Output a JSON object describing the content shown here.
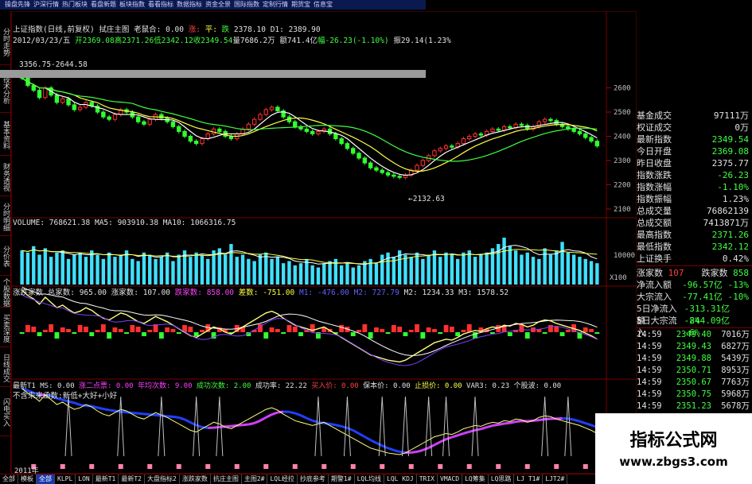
{
  "topbar": {
    "items": [
      "操盘先锋",
      "沪深行情",
      "热门板块",
      "看盘新题",
      "板块指数",
      "看看指标",
      "数据指标",
      "资金全景",
      "国际指数",
      "定制行情",
      "期货宝",
      "信息宝"
    ]
  },
  "left_tabs": [
    "分时走势",
    "技术分析",
    "基本资料",
    "财务透视",
    "分时明细",
    "分价表",
    "个股数据",
    "买卖深度",
    "日线成交",
    "闪电买入"
  ],
  "price_header": {
    "line1_title": "上证指数",
    "line1_sub": "(日线,前复权)",
    "line1_main": "拭庄主图",
    "line1_ratio": "老鼠合: 0.00",
    "line1_up": "涨:",
    "line1_flat": "平:",
    "line1_down": "跌",
    "line1_v1": "2378.10",
    "line1_d1": "D1: 2389.90",
    "line2_date": "2012/03/23/五",
    "line2_open": "开2369.08",
    "line2_high": "高2371.26",
    "line2_low": "低2342.12",
    "line2_close": "收2349.54",
    "line2_vol": "量7686.2万",
    "line2_amt": "额741.4亿",
    "line2_chg": "幅-26.23(-1.10%)",
    "line2_amp": "振29.14(1.23%"
  },
  "price_annotations": {
    "high_label": "3356.75-2644.58",
    "low_label": "←2132.63"
  },
  "volume_header": {
    "vol": "VOLUME: 768621.38",
    "ma5": "MA5: 903910.38",
    "ma10": "MA10: 1066316.75"
  },
  "adl_header": {
    "title": "涨跌家数",
    "total": "总家数: 965.00",
    "up": "涨家数: 107.00",
    "down": "跌家数: 858.00",
    "diff": "差数: -751.00",
    "m1": "M1: -476.00",
    "m1b": "M2: 727.79",
    "m2": "M2: 1234.33",
    "m3": "M3: 1578.52"
  },
  "ind_header": {
    "l1_a": "最新T1",
    "l1_b": "MS: 0.00",
    "l1_c": "涨二点票: 0.00",
    "l1_d": "年均次数: 9.00",
    "l1_e": "成功次数: 2.00",
    "l1_f": "成功率: 22.22",
    "l1_g": "买入价: 0.00",
    "l1_h": "保本价: 0.00",
    "l1_i": "止损价: 0.00",
    "l1_j": "VAR3: 0.23",
    "l1_k": "个股波: 0.00",
    "l2": "不含未来函数:新低+大好+小好"
  },
  "price_axis": [
    "2600",
    "2500",
    "2400",
    "2300",
    "2200",
    "2100"
  ],
  "volume_axis": [
    "10000",
    "X100"
  ],
  "right_panel": {
    "rows": [
      {
        "k": "基金成交",
        "v": "97111万",
        "c": "w"
      },
      {
        "k": "权证成交",
        "v": "0万",
        "c": "w"
      },
      {
        "k": "最新指数",
        "v": "2349.54",
        "c": "g"
      },
      {
        "k": "今日开盘",
        "v": "2369.08",
        "c": "g"
      },
      {
        "k": "昨日收盘",
        "v": "2375.77",
        "c": "w"
      },
      {
        "k": "指数涨跌",
        "v": "-26.23",
        "c": "g"
      },
      {
        "k": "指数涨幅",
        "v": "-1.10%",
        "c": "g"
      },
      {
        "k": "指数振幅",
        "v": "1.23%",
        "c": "w"
      },
      {
        "k": "总成交量",
        "v": "76862139",
        "c": "w"
      },
      {
        "k": "总成交额",
        "v": "7413871万",
        "c": "w"
      },
      {
        "k": "最高指数",
        "v": "2371.26",
        "c": "g"
      },
      {
        "k": "最低指数",
        "v": "2342.12",
        "c": "g"
      },
      {
        "k": "上证换手",
        "v": "0.42%",
        "c": "w"
      }
    ],
    "updown": {
      "up_label": "涨家数",
      "up_val": "107",
      "down_label": "跌家数",
      "down_val": "858"
    },
    "flows": [
      {
        "k": "净流入额",
        "v": "-96.57亿",
        "p": "-13%"
      },
      {
        "k": "大宗流入",
        "v": "-77.41亿",
        "p": "-10%"
      },
      {
        "k": "5日净流入额",
        "v": "-313.31亿",
        "p": "-8%"
      },
      {
        "k": "5日大宗流入",
        "v": "-244.09亿",
        "p": "-6%"
      }
    ],
    "ticks": [
      {
        "t": "14:59",
        "p": "2349.40",
        "v": "7016万"
      },
      {
        "t": "14:59",
        "p": "2349.43",
        "v": "6827万"
      },
      {
        "t": "14:59",
        "p": "2349.88",
        "v": "5439万"
      },
      {
        "t": "14:59",
        "p": "2350.71",
        "v": "8953万"
      },
      {
        "t": "14:59",
        "p": "2350.67",
        "v": "7763万"
      },
      {
        "t": "14:59",
        "p": "2350.75",
        "v": "5968万"
      },
      {
        "t": "14:59",
        "p": "2351.23",
        "v": "5678万"
      }
    ]
  },
  "watermark": {
    "line1": "指标公式网",
    "line2": "www.zbgs3.com"
  },
  "bottom_tabs": [
    "全部",
    "模板",
    "全部",
    "KLPL",
    "LON",
    "最新T1",
    "最新T2",
    "大盘指标2",
    "涨跌家数",
    "抗庄主图",
    "主图2#",
    "LQL经拉",
    "抄底参考",
    "期警1#",
    "LQL均线",
    "LQL KDJ",
    "TRIX",
    "VMACD",
    "LQ筹集",
    "LQ思路",
    "LJ T1#",
    "LJT2#"
  ],
  "bottom_active_index": 2,
  "year_label": "2011年",
  "chart_data": {
    "type": "candlestick",
    "price_range": [
      2080,
      2720
    ],
    "closes": [
      2640,
      2610,
      2590,
      2560,
      2600,
      2570,
      2540,
      2555,
      2530,
      2510,
      2520,
      2540,
      2525,
      2500,
      2480,
      2470,
      2490,
      2510,
      2500,
      2480,
      2460,
      2450,
      2470,
      2490,
      2475,
      2460,
      2440,
      2420,
      2400,
      2380,
      2370,
      2390,
      2410,
      2430,
      2420,
      2400,
      2390,
      2410,
      2430,
      2450,
      2470,
      2490,
      2510,
      2520,
      2505,
      2480,
      2460,
      2440,
      2430,
      2420,
      2410,
      2420,
      2430,
      2410,
      2390,
      2370,
      2350,
      2330,
      2310,
      2290,
      2270,
      2260,
      2250,
      2240,
      2235,
      2230,
      2240,
      2260,
      2280,
      2300,
      2320,
      2340,
      2350,
      2360,
      2355,
      2370,
      2390,
      2400,
      2410,
      2405,
      2420,
      2430,
      2425,
      2440,
      2435,
      2450,
      2445,
      2430,
      2440,
      2460,
      2470,
      2465,
      2450,
      2440,
      2430,
      2420,
      2410,
      2395,
      2380,
      2360
    ],
    "volume": [
      80,
      75,
      90,
      70,
      85,
      65,
      75,
      80,
      60,
      70,
      75,
      65,
      80,
      70,
      60,
      75,
      65,
      70,
      80,
      60,
      55,
      75,
      70,
      60,
      65,
      75,
      55,
      70,
      80,
      65,
      75,
      70,
      60,
      80,
      85,
      70,
      95,
      65,
      70,
      60,
      55,
      70,
      75,
      60,
      65,
      50,
      55,
      45,
      50,
      60,
      45,
      40,
      50,
      55,
      60,
      45,
      50,
      40,
      45,
      55,
      60,
      50,
      70,
      75,
      65,
      80,
      70,
      65,
      75,
      60,
      70,
      80,
      65,
      75,
      70,
      60,
      75,
      80,
      65,
      70,
      75,
      85,
      95,
      110,
      90,
      80,
      70,
      75,
      65,
      60,
      85,
      70,
      80,
      100,
      75,
      70,
      65,
      60,
      55,
      50
    ]
  }
}
